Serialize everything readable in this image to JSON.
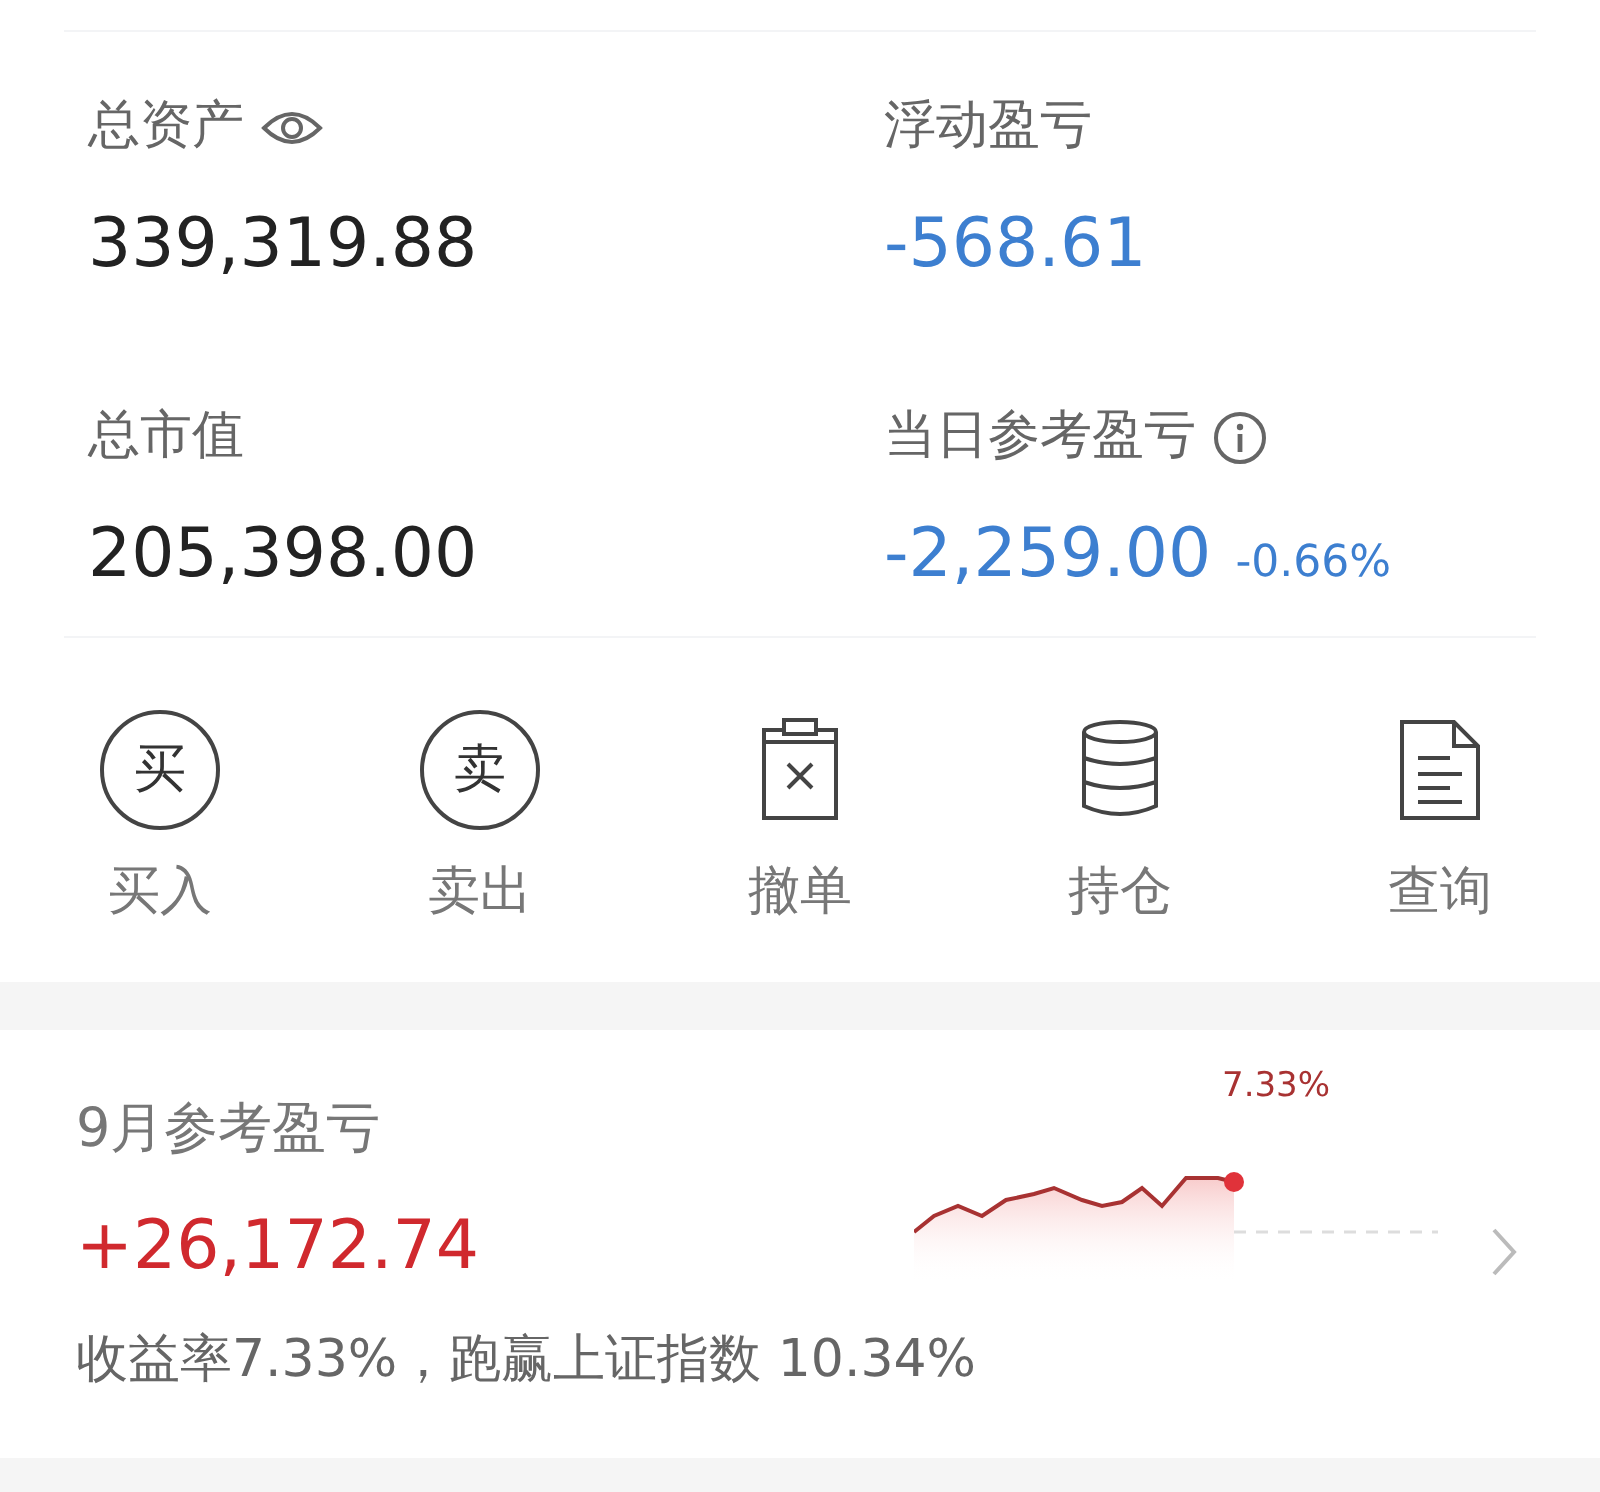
{
  "summary": [
    {
      "label": "总资产",
      "eye": true,
      "value": "339,319.88",
      "color": "#222222"
    },
    {
      "label": "浮动盈亏",
      "value": "-568.61",
      "color": "#3d7fd0"
    },
    {
      "label": "总市值",
      "value": "205,398.00",
      "color": "#222222"
    },
    {
      "label": "当日参考盈亏",
      "info": true,
      "value": "-2,259.00",
      "color": "#3d7fd0",
      "change": "-0.66%"
    }
  ],
  "actions": [
    {
      "kind": "glyph",
      "glyph": "买",
      "label": "买入"
    },
    {
      "kind": "glyph",
      "glyph": "卖",
      "label": "卖出"
    },
    {
      "kind": "cancel",
      "label": "撤单"
    },
    {
      "kind": "stack",
      "label": "持仓"
    },
    {
      "kind": "doc",
      "label": "查询"
    }
  ],
  "monthly": {
    "title": "9月参考盈亏",
    "value": "+26,172.74",
    "sparkline_label": "7.33%",
    "note": "收益率7.33%，跑赢上证指数 10.34%"
  }
}
